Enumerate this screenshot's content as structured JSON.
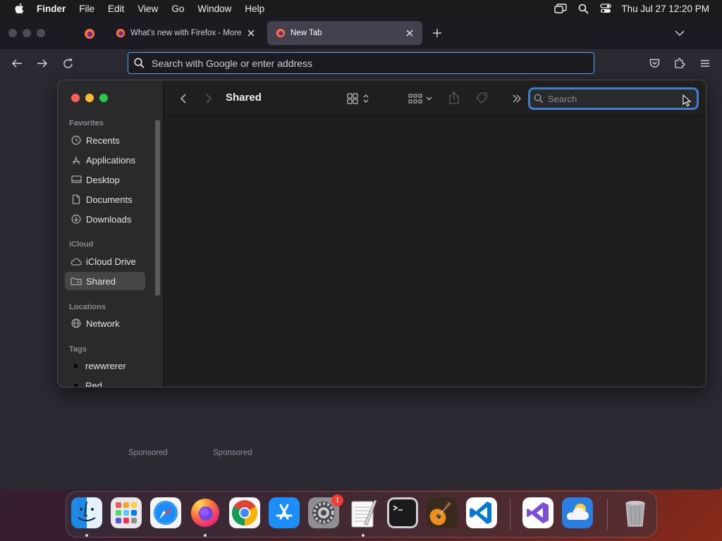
{
  "menubar": {
    "app_name": "Finder",
    "items": [
      "File",
      "Edit",
      "View",
      "Go",
      "Window",
      "Help"
    ],
    "clock": "Thu Jul 27  12:20 PM",
    "icons": [
      "screen-mirroring-icon",
      "spotlight-search-icon",
      "control-center-icon"
    ]
  },
  "firefox": {
    "tabs": [
      {
        "label": "What's new with Firefox - More"
      },
      {
        "label": "New Tab"
      }
    ],
    "urlbar_placeholder": "Search with Google or enter address",
    "sponsored": [
      "Sponsored",
      "Sponsored"
    ]
  },
  "finder": {
    "title": "Shared",
    "search_placeholder": "Search",
    "sidebar": {
      "favorites_header": "Favorites",
      "favorites": [
        {
          "label": "Recents",
          "icon": "clock-icon"
        },
        {
          "label": "Applications",
          "icon": "applications-icon"
        },
        {
          "label": "Desktop",
          "icon": "desktop-icon"
        },
        {
          "label": "Documents",
          "icon": "document-icon"
        },
        {
          "label": "Downloads",
          "icon": "download-icon"
        }
      ],
      "icloud_header": "iCloud",
      "icloud": [
        {
          "label": "iCloud Drive",
          "icon": "cloud-icon"
        },
        {
          "label": "Shared",
          "icon": "shared-folder-icon",
          "selected": true
        }
      ],
      "locations_header": "Locations",
      "locations": [
        {
          "label": "Network",
          "icon": "globe-icon"
        }
      ],
      "tags_header": "Tags",
      "tags": [
        {
          "label": "rewwrerer",
          "color": "#0a0a0a"
        },
        {
          "label": "Red",
          "color": "#0a0a0a"
        }
      ]
    }
  },
  "dock": {
    "apps": [
      "Finder",
      "Launchpad",
      "Safari",
      "Firefox",
      "Chrome",
      "App Store",
      "System Settings",
      "TextEdit",
      "Terminal",
      "GarageBand",
      "Visual Studio Code",
      "Visual Studio",
      "Weather",
      "Trash"
    ],
    "badge": "1"
  },
  "colors": {
    "accent": "#3f7fcf",
    "url_focus": "#5ca9ee",
    "traffic_close": "#ff5f57",
    "traffic_min": "#febc2e",
    "traffic_max": "#28c840"
  }
}
